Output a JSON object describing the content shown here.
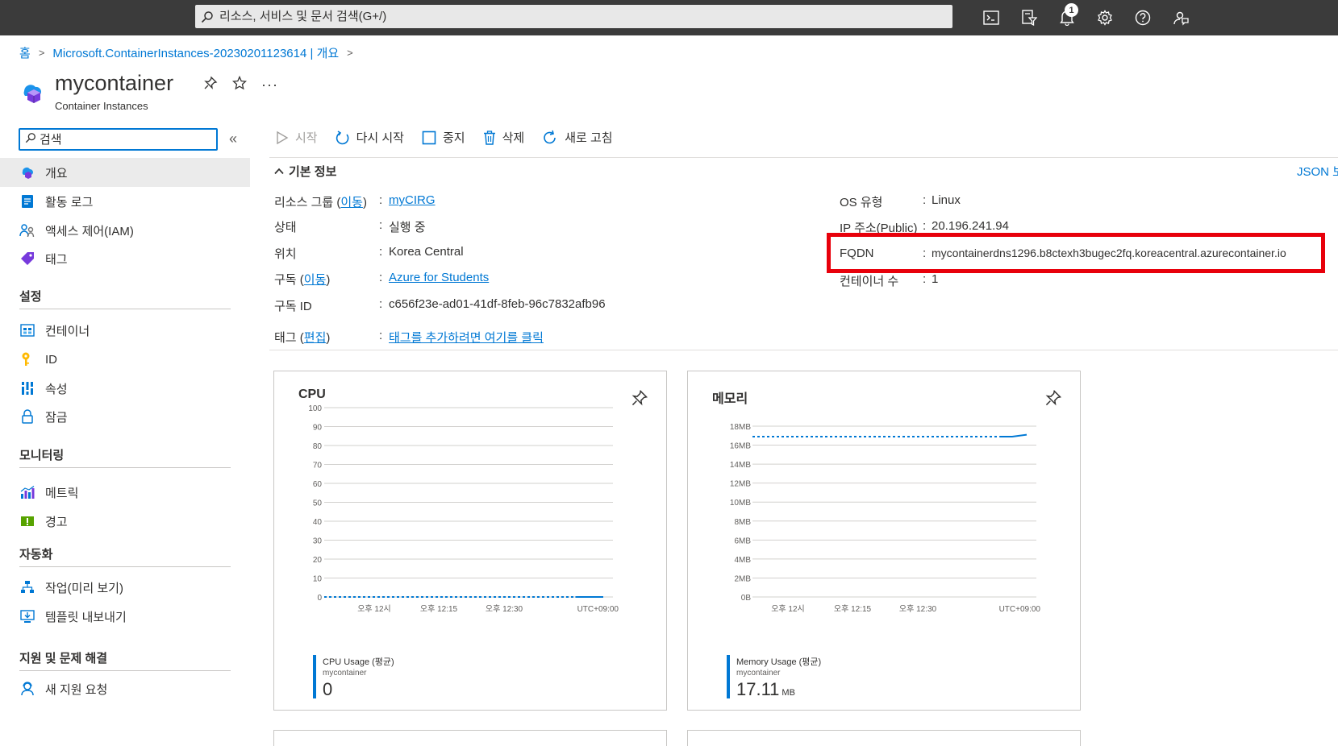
{
  "topbar": {
    "search_placeholder": "리소스, 서비스 및 문서 검색(G+/)",
    "notification_count": "1",
    "icons": [
      "cloud-shell-icon",
      "directory-filter-icon",
      "notifications-icon",
      "settings-icon",
      "help-icon",
      "feedback-icon"
    ]
  },
  "breadcrumb": {
    "home": "홈",
    "deployment": "Microsoft.ContainerInstances-20230201123614 | 개요"
  },
  "header": {
    "title": "mycontainer",
    "subtitle": "Container Instances"
  },
  "sidebar": {
    "search_placeholder": "검색",
    "top_items": [
      {
        "label": "개요",
        "icon": "overview-icon"
      },
      {
        "label": "활동 로그",
        "icon": "activity-log-icon"
      },
      {
        "label": "액세스 제어(IAM)",
        "icon": "iam-icon"
      },
      {
        "label": "태그",
        "icon": "tag-icon"
      }
    ],
    "sections": [
      {
        "title": "설정",
        "items": [
          {
            "label": "컨테이너",
            "icon": "containers-icon"
          },
          {
            "label": "ID",
            "icon": "identity-icon"
          },
          {
            "label": "속성",
            "icon": "properties-icon"
          },
          {
            "label": "잠금",
            "icon": "lock-icon"
          }
        ]
      },
      {
        "title": "모니터링",
        "items": [
          {
            "label": "메트릭",
            "icon": "metrics-icon"
          },
          {
            "label": "경고",
            "icon": "alerts-icon"
          }
        ]
      },
      {
        "title": "자동화",
        "items": [
          {
            "label": "작업(미리 보기)",
            "icon": "tasks-icon"
          },
          {
            "label": "템플릿 내보내기",
            "icon": "export-template-icon"
          }
        ]
      },
      {
        "title": "지원 및 문제 해결",
        "items": [
          {
            "label": "새 지원 요청",
            "icon": "support-request-icon"
          }
        ]
      }
    ]
  },
  "commands": {
    "start": "시작",
    "restart": "다시 시작",
    "stop": "중지",
    "delete": "삭제",
    "refresh": "새로 고침"
  },
  "essentials": {
    "header": "기본 정보",
    "json_view": "JSON 보",
    "left": {
      "resource_group_label": "리소스 그룹",
      "move_link": "이동",
      "resource_group_value": "myCIRG",
      "status_label": "상태",
      "status_value": "실행 중",
      "location_label": "위치",
      "location_value": "Korea Central",
      "subscription_label": "구독",
      "subscription_value": "Azure for Students",
      "subscription_id_label": "구독 ID",
      "subscription_id_value": "c656f23e-ad01-41df-8feb-96c7832afb96",
      "tags_label": "태그",
      "edit_link": "편집",
      "tags_value": "태그를 추가하려면 여기를 클릭"
    },
    "right": {
      "os_label": "OS 유형",
      "os_value": "Linux",
      "ip_label": "IP 주소(Public)",
      "ip_value": "20.196.241.94",
      "fqdn_label": "FQDN",
      "fqdn_value": "mycontainerdns1296.b8ctexh3bugec2fq.koreacentral.azurecontainer.io",
      "container_count_label": "컨테이너 수",
      "container_count_value": "1"
    },
    "highlight_color": "#e8000b"
  },
  "chart_data": [
    {
      "type": "line",
      "title": "CPU",
      "y_ticks": [
        "100",
        "90",
        "80",
        "70",
        "60",
        "50",
        "40",
        "30",
        "20",
        "10",
        "0"
      ],
      "ylim": [
        0,
        100
      ],
      "x_ticks": [
        "오후 12시",
        "오후 12:15",
        "오후 12:30",
        "UTC+09:00"
      ],
      "series": [
        {
          "name": "CPU Usage (평균)",
          "resource": "mycontainer",
          "values": [
            0,
            0
          ],
          "style": "dotted then solid"
        }
      ],
      "summary_value": "0",
      "summary_unit": "",
      "color": "#0078d4",
      "grid": true
    },
    {
      "type": "line",
      "title": "메모리",
      "y_ticks": [
        "18MB",
        "16MB",
        "14MB",
        "12MB",
        "10MB",
        "8MB",
        "6MB",
        "4MB",
        "2MB",
        "0B"
      ],
      "ylim": [
        0,
        18
      ],
      "x_ticks": [
        "오후 12시",
        "오후 12:15",
        "오후 12:30",
        "UTC+09:00"
      ],
      "series": [
        {
          "name": "Memory Usage (평균)",
          "resource": "mycontainer",
          "values": [
            16.9,
            17.1
          ],
          "style": "dotted then solid"
        }
      ],
      "summary_value": "17.11",
      "summary_unit": "MB",
      "color": "#0078d4",
      "grid": true
    }
  ]
}
